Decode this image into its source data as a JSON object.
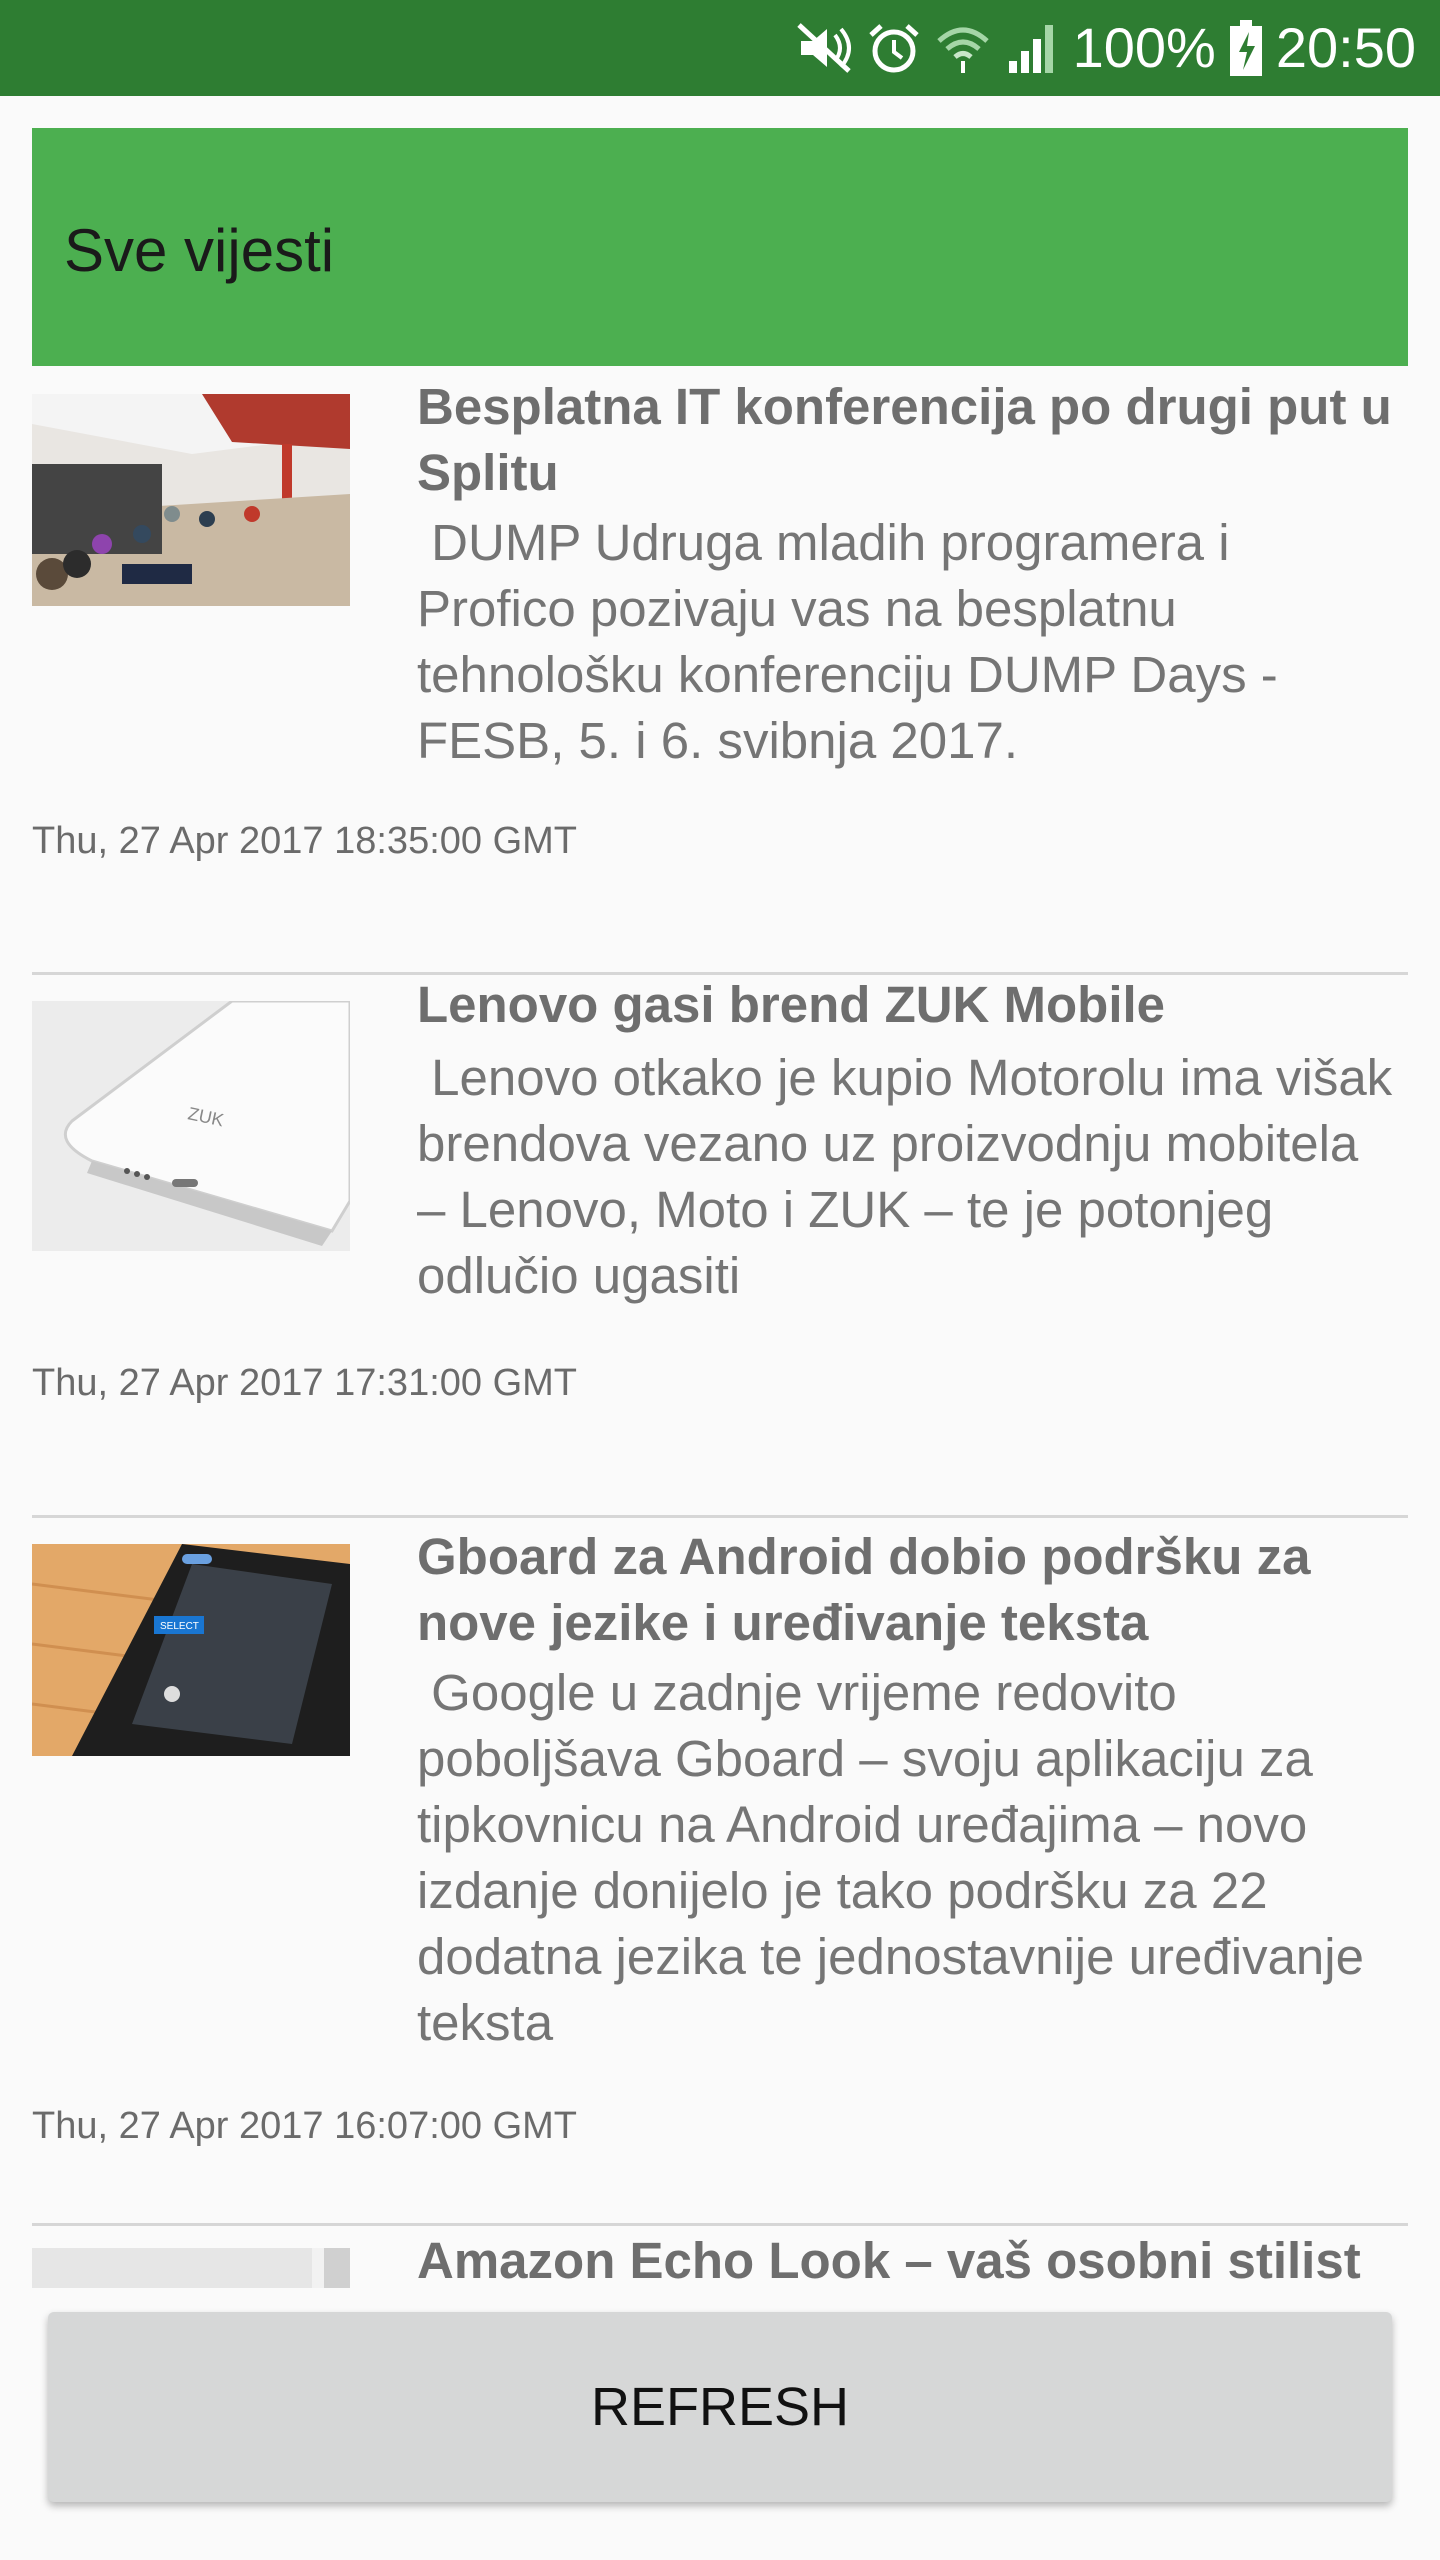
{
  "status_bar": {
    "battery": "100%",
    "time": "20:50",
    "icons": [
      "mute-icon",
      "alarm-icon",
      "wifi-icon",
      "signal-icon",
      "battery-charging-icon"
    ]
  },
  "header": {
    "title": "Sve vijesti"
  },
  "articles": [
    {
      "title": "Besplatna IT konferencija po drugi put u Splitu",
      "description": " DUMP Udruga mladih programera i Profico pozivaju vas na besplatnu tehnološku konferenciju DUMP Days - FESB, 5. i 6. svibnja 2017.",
      "date": "Thu, 27 Apr 2017 18:35:00 GMT",
      "thumb": "conference-photo"
    },
    {
      "title": "Lenovo gasi brend ZUK Mobile",
      "description": " Lenovo otkako je kupio Motorolu ima višak brendova vezano uz proizvodnju mobitela – Lenovo, Moto i ZUK – te je potonjeg odlučio ugasiti",
      "date": "Thu, 27 Apr 2017 17:31:00 GMT",
      "thumb": "zuk-phone-photo",
      "thumb_text": "ZUK"
    },
    {
      "title": "Gboard za Android dobio podršku za nove jezike i uređivanje teksta",
      "description": " Google u zadnje vrijeme redovito poboljšava Gboard – svoju aplikaciju za tipkovnicu na Android uređajima – novo izdanje donijelo je tako podršku za 22 dodatna jezika te jednostavnije uređivanje teksta",
      "date": "Thu, 27 Apr 2017 16:07:00 GMT",
      "thumb": "gboard-phone-photo",
      "thumb_text": "SELECT"
    },
    {
      "title": "Amazon Echo Look – vaš osobni stilist",
      "thumb": "echo-look-photo"
    }
  ],
  "refresh_button": {
    "label": "REFRESH"
  },
  "colors": {
    "status_bar": "#2e7d32",
    "header": "#4caf50",
    "button": "#d6d7d7"
  }
}
